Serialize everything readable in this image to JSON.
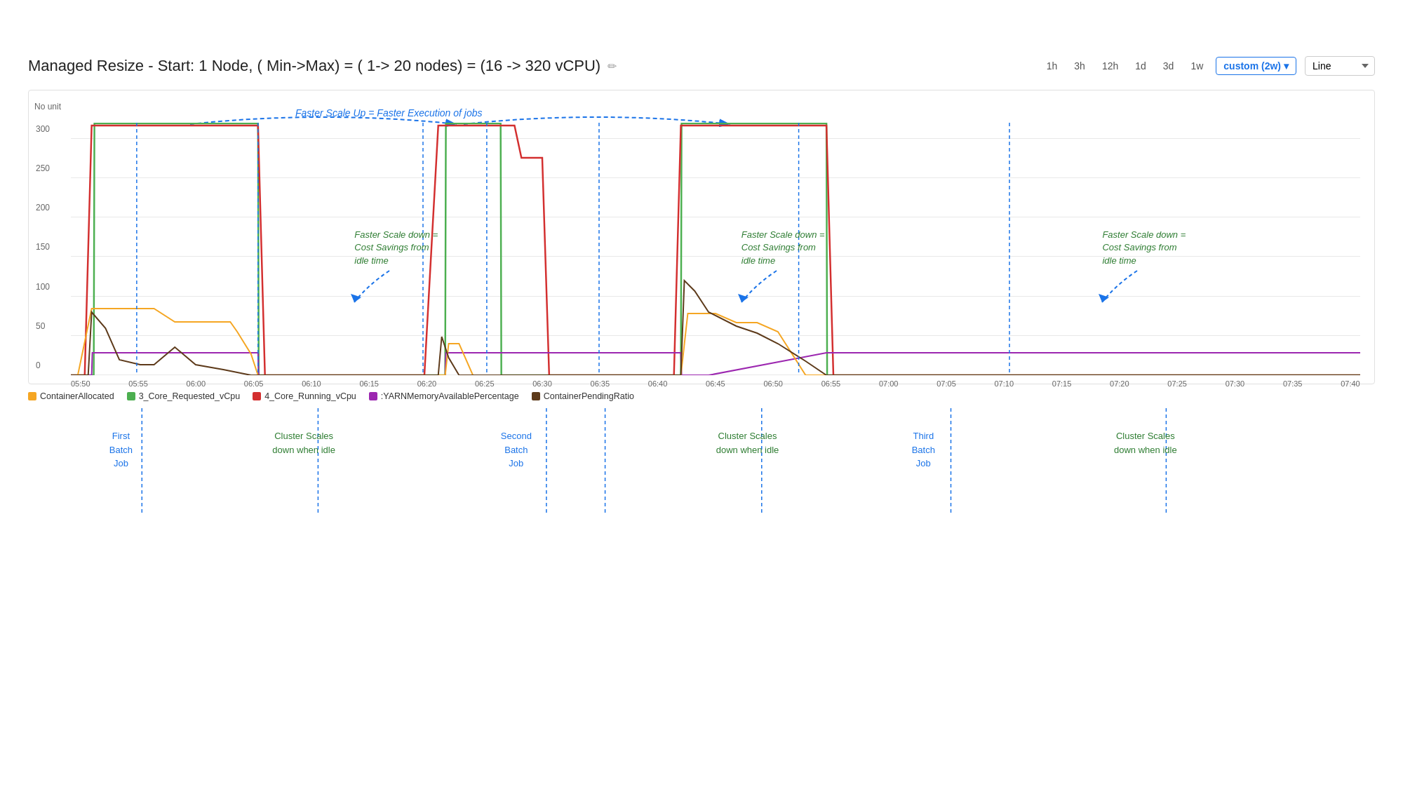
{
  "title": "Managed Resize - Start: 1 Node, ( Min->Max) = ( 1-> 20 nodes) = (16 -> 320 vCPU)",
  "edit_icon": "✏",
  "time_buttons": [
    "1h",
    "3h",
    "12h",
    "1d",
    "3d",
    "1w"
  ],
  "active_time": "custom (2w)",
  "chart_type": "Line",
  "y_axis_label": "No unit",
  "y_ticks": [
    "0",
    "50",
    "100",
    "150",
    "200",
    "250",
    "300"
  ],
  "x_ticks": [
    "05:50",
    "05:55",
    "06:00",
    "06:05",
    "06:10",
    "06:15",
    "06:20",
    "06:25",
    "06:30",
    "06:35",
    "06:40",
    "06:45",
    "06:50",
    "06:55",
    "07:00",
    "07:05",
    "07:10",
    "07:15",
    "07:20",
    "07:25",
    "07:30",
    "07:35",
    "07:40"
  ],
  "annotation_top": "Faster Scale Up =  Faster Execution of jobs",
  "annotation_down1": "Faster Scale down =\nCost Savings from\nidle time",
  "annotation_down2": "Faster Scale down =\nCost Savings from\nidle time",
  "annotation_down3": "Faster Scale down =\nCost Savings from\nidle time",
  "legend": [
    {
      "label": "ContainerAllocated",
      "color": "#f5a623"
    },
    {
      "label": "3_Core_Requested_vCpu",
      "color": "#4caf50"
    },
    {
      "label": "4_Core_Running_vCpu",
      "color": "#d32f2f"
    },
    {
      "label": ":YARNMemoryAvailablePercentage",
      "color": "#9c27b0"
    },
    {
      "label": "ContainerPendingRatio",
      "color": "#5d3a1a"
    }
  ],
  "below_annotations": [
    {
      "label": "First\nBatch\nJob",
      "color": "blue",
      "left_pct": 6
    },
    {
      "label": "Cluster Scales\ndown when idle",
      "color": "green",
      "left_pct": 19
    },
    {
      "label": "Second\nBatch\nJob",
      "color": "blue",
      "left_pct": 37
    },
    {
      "label": "Cluster Scales\ndown when idle",
      "color": "green",
      "left_pct": 53
    },
    {
      "label": "Third\nBatch\nJob",
      "color": "blue",
      "left_pct": 67
    },
    {
      "label": "Cluster Scales\ndown when idle",
      "color": "green",
      "left_pct": 84
    }
  ]
}
